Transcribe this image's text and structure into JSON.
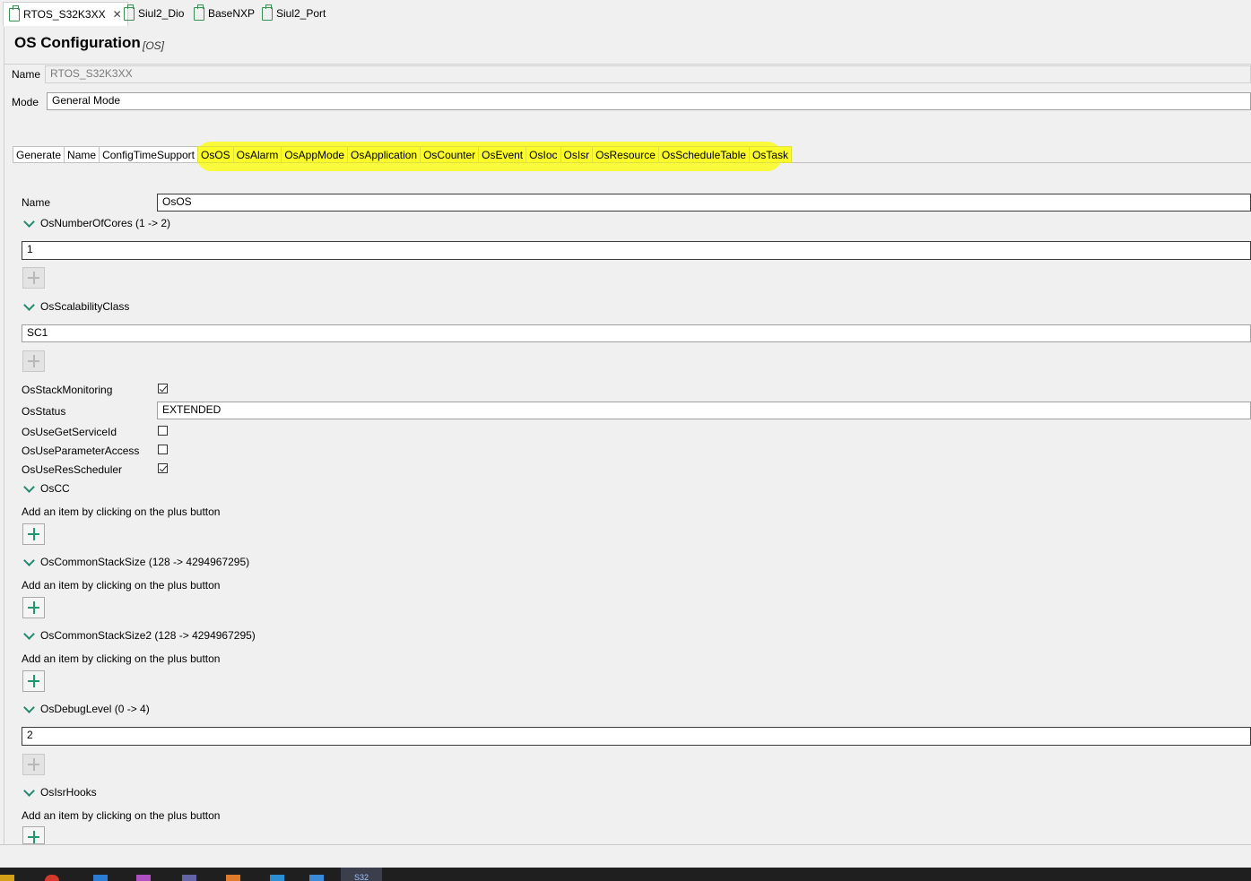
{
  "editor_tabs": [
    {
      "label": "RTOS_S32K3XX",
      "active": true
    },
    {
      "label": "Siul2_Dio",
      "active": false
    },
    {
      "label": "BaseNXP",
      "active": false
    },
    {
      "label": "Siul2_Port",
      "active": false
    }
  ],
  "header": {
    "title": "OS Configuration",
    "subtitle": "[OS]"
  },
  "name_field": {
    "label": "Name",
    "value": "RTOS_S32K3XX"
  },
  "mode_field": {
    "label": "Mode",
    "value": "General Mode"
  },
  "tabs": [
    "Generate",
    "Name",
    "ConfigTimeSupport",
    "OsOS",
    "OsAlarm",
    "OsAppMode",
    "OsApplication",
    "OsCounter",
    "OsEvent",
    "OsIoc",
    "OsIsr",
    "OsResource",
    "OsScheduleTable",
    "OsTask"
  ],
  "highlight_color": "#fafa3c",
  "accent_color": "#1c9a6e",
  "content": {
    "name": {
      "label": "Name",
      "value": "OsOS"
    },
    "cores": {
      "label": "OsNumberOfCores (1 -> 2)",
      "value": "1"
    },
    "scal": {
      "label": "OsScalabilityClass",
      "value": "SC1"
    },
    "stackmon": {
      "label": "OsStackMonitoring",
      "checked": true
    },
    "status": {
      "label": "OsStatus",
      "value": "EXTENDED"
    },
    "getserv": {
      "label": "OsUseGetServiceId",
      "checked": false
    },
    "param": {
      "label": "OsUseParameterAccess",
      "checked": false
    },
    "ressched": {
      "label": "OsUseResScheduler",
      "checked": true
    },
    "cc": {
      "label": "OsCC"
    },
    "stack": {
      "label": "OsCommonStackSize (128 -> 4294967295)"
    },
    "stack2": {
      "label": "OsCommonStackSize2 (128 -> 4294967295)"
    },
    "debug": {
      "label": "OsDebugLevel (0 -> 4)",
      "value": "2"
    },
    "isrhooks": {
      "label": "OsIsrHooks"
    },
    "add_hint": "Add an item by clicking on the plus button"
  },
  "taskbar": {
    "active_label": "S32"
  }
}
